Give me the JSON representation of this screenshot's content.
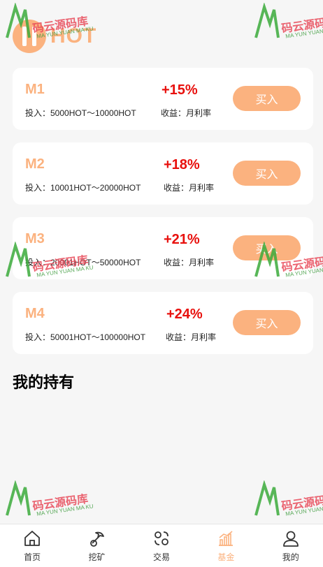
{
  "header": {
    "logo_text": "HOT"
  },
  "funds": [
    {
      "name": "M1",
      "rate": "+15%",
      "invest": "投入：5000HOT〜10000HOT",
      "income": "收益：月利率",
      "buy_label": "买入"
    },
    {
      "name": "M2",
      "rate": "+18%",
      "invest": "投入：10001HOT〜20000HOT",
      "income": "收益：月利率",
      "buy_label": "买入"
    },
    {
      "name": "M3",
      "rate": "+21%",
      "invest": "投入：20001HOT〜50000HOT",
      "income": "收益：月利率",
      "buy_label": "买入"
    },
    {
      "name": "M4",
      "rate": "+24%",
      "invest": "投入：50001HOT〜100000HOT",
      "income": "收益：月利率",
      "buy_label": "买入"
    }
  ],
  "holdings": {
    "title": "我的持有"
  },
  "tabbar": {
    "items": [
      {
        "label": "首页",
        "icon": "home-icon"
      },
      {
        "label": "挖矿",
        "icon": "mining-icon"
      },
      {
        "label": "交易",
        "icon": "trade-icon"
      },
      {
        "label": "基金",
        "icon": "fund-chart-icon"
      },
      {
        "label": "我的",
        "icon": "user-icon"
      }
    ],
    "active_index": 3
  },
  "watermark": {
    "text": "码云源码库",
    "subtext": "MA YUN YUAN MA KU"
  },
  "colors": {
    "accent": "#fbb27f",
    "rate": "#e8100d",
    "background": "#f6f6f6"
  }
}
